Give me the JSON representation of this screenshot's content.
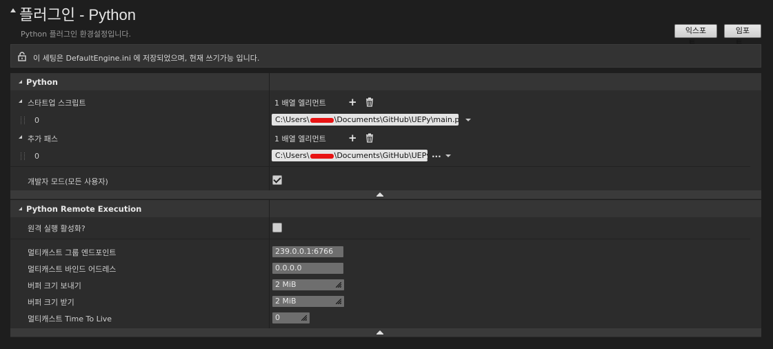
{
  "header": {
    "title": "플러그인 - Python",
    "subtitle": "Python 플러그인 환경설정입니다.",
    "export_label": "익스포트...",
    "import_label": "임포트..."
  },
  "notice": {
    "text": "이 세팅은 DefaultEngine.ini 에 저장되었으며, 현재 쓰기가능 입니다."
  },
  "python_section": {
    "title": "Python",
    "startup_scripts": {
      "label": "스타트업 스크립트",
      "count_label": "1 배열 엘리먼트",
      "items": [
        {
          "index": "0",
          "path_prefix": "C:\\Users\\",
          "path_suffix": "\\Documents\\GitHub\\UEPy\\main.py"
        }
      ]
    },
    "additional_paths": {
      "label": "추가 패스",
      "count_label": "1 배열 엘리먼트",
      "items": [
        {
          "index": "0",
          "path_prefix": "C:\\Users\\",
          "path_suffix": "\\Documents\\GitHub\\UEPy"
        }
      ]
    },
    "developer_mode": {
      "label": "개발자 모드(모든 사용자)",
      "checked": true
    }
  },
  "remote_section": {
    "title": "Python Remote Execution",
    "enable_remote": {
      "label": "원격 실행 활성화?",
      "checked": false
    },
    "fields": [
      {
        "label": "멀티캐스트 그룹 엔드포인트",
        "value": "239.0.0.1:6766"
      },
      {
        "label": "멀티캐스트 바인드 어드레스",
        "value": "0.0.0.0"
      },
      {
        "label": "버퍼 크기 보내기",
        "value": "2 MiB"
      },
      {
        "label": "버퍼 크기 받기",
        "value": "2 MiB"
      },
      {
        "label": "멀티캐스트 Time To Live",
        "value": "0"
      }
    ]
  },
  "colors": {
    "background": "#1e1e1e",
    "panel": "#2c2c2c",
    "header": "#353535",
    "redaction": "#e81414"
  },
  "icons": [
    "lock-icon",
    "plus-icon",
    "trash-icon",
    "dropdown-arrow-icon",
    "ellipsis-icon",
    "collapse-arrow-icon",
    "resize-icon",
    "checkmark-icon"
  ]
}
